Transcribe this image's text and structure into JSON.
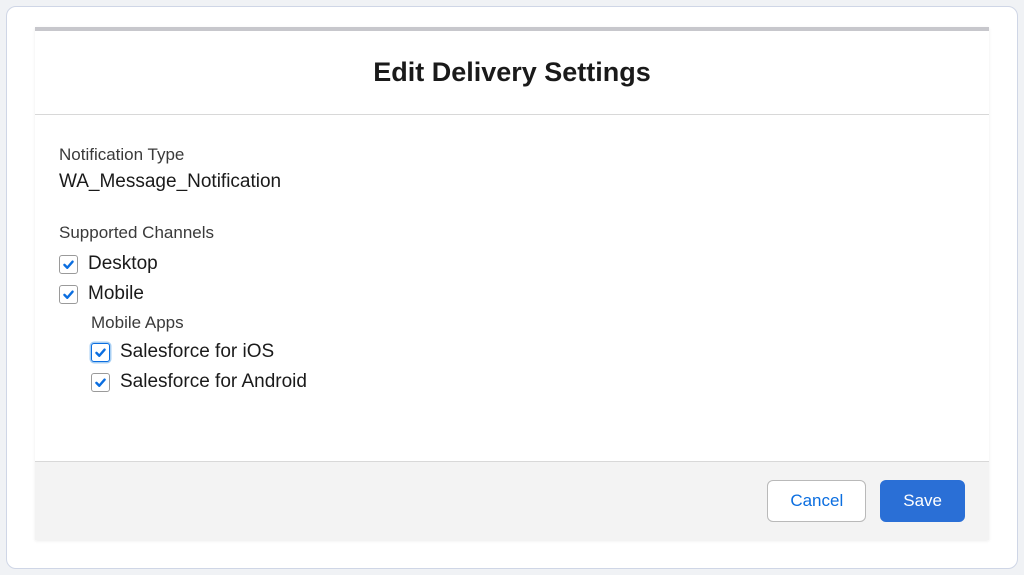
{
  "modal": {
    "title": "Edit Delivery Settings",
    "notification_type_label": "Notification Type",
    "notification_type_value": "WA_Message_Notification",
    "supported_channels_label": "Supported Channels",
    "channels": {
      "desktop": {
        "label": "Desktop",
        "checked": true
      },
      "mobile": {
        "label": "Mobile",
        "checked": true
      }
    },
    "mobile_apps_label": "Mobile Apps",
    "mobile_apps": {
      "ios": {
        "label": "Salesforce for iOS",
        "checked": true,
        "focused": true
      },
      "android": {
        "label": "Salesforce for Android",
        "checked": true
      }
    },
    "footer": {
      "cancel_label": "Cancel",
      "save_label": "Save"
    }
  }
}
